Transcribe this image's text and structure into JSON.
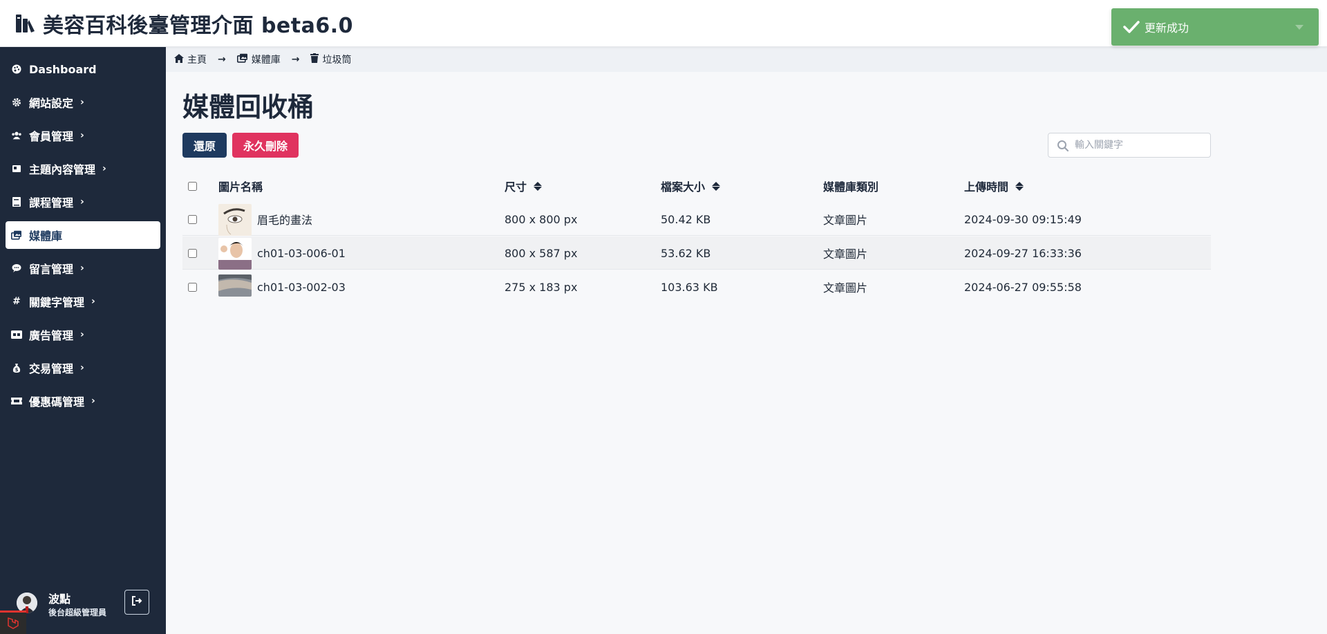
{
  "header": {
    "title": "美容百科後臺管理介面 beta6.0",
    "logo_icon": "laravel-book-icon"
  },
  "toast": {
    "message": "更新成功",
    "color": "#6ab06e"
  },
  "sidebar": {
    "bg": "#1e293b",
    "items": [
      {
        "label": "Dashboard",
        "icon": "palette-icon",
        "has_children": false,
        "active": false
      },
      {
        "label": "網站設定",
        "icon": "gear-icon",
        "has_children": true,
        "active": false
      },
      {
        "label": "會員管理",
        "icon": "users-icon",
        "has_children": true,
        "active": false
      },
      {
        "label": "主題內容管理",
        "icon": "book-open-icon",
        "has_children": true,
        "active": false
      },
      {
        "label": "課程管理",
        "icon": "book-icon",
        "has_children": true,
        "active": false
      },
      {
        "label": "媒體庫",
        "icon": "images-icon",
        "has_children": false,
        "active": true
      },
      {
        "label": "留言管理",
        "icon": "comment-icon",
        "has_children": true,
        "active": false
      },
      {
        "label": "關鍵字管理",
        "icon": "hashtag-icon",
        "has_children": true,
        "active": false
      },
      {
        "label": "廣告管理",
        "icon": "ad-icon",
        "has_children": true,
        "active": false
      },
      {
        "label": "交易管理",
        "icon": "money-bag-icon",
        "has_children": true,
        "active": false
      },
      {
        "label": "優惠碼管理",
        "icon": "ticket-icon",
        "has_children": true,
        "active": false
      }
    ],
    "user": {
      "name": "波點",
      "role": "後台超級管理員"
    }
  },
  "breadcrumb": [
    {
      "label": "主頁",
      "icon": "home-icon"
    },
    {
      "label": "媒體庫",
      "icon": "images-icon"
    },
    {
      "label": "垃圾筒",
      "icon": "trash-icon"
    }
  ],
  "page": {
    "title": "媒體回收桶",
    "restore_label": "還原",
    "delete_label": "永久刪除",
    "search_placeholder": "輸入關鍵字",
    "accent": "#1e3a5f",
    "danger": "#e0335f"
  },
  "table": {
    "columns": [
      "圖片名稱",
      "尺寸",
      "檔案大小",
      "媒體庫類別",
      "上傳時間"
    ],
    "rows": [
      {
        "name": "眉毛的畫法",
        "size": "800 x 800 px",
        "filesize": "50.42 KB",
        "category": "文章圖片",
        "uploaded": "2024-09-30 09:15:49"
      },
      {
        "name": "ch01-03-006-01",
        "size": "800 x 587 px",
        "filesize": "53.62 KB",
        "category": "文章圖片",
        "uploaded": "2024-09-27 16:33:36"
      },
      {
        "name": "ch01-03-002-03",
        "size": "275 x 183 px",
        "filesize": "103.63 KB",
        "category": "文章圖片",
        "uploaded": "2024-06-27 09:55:58"
      }
    ]
  }
}
